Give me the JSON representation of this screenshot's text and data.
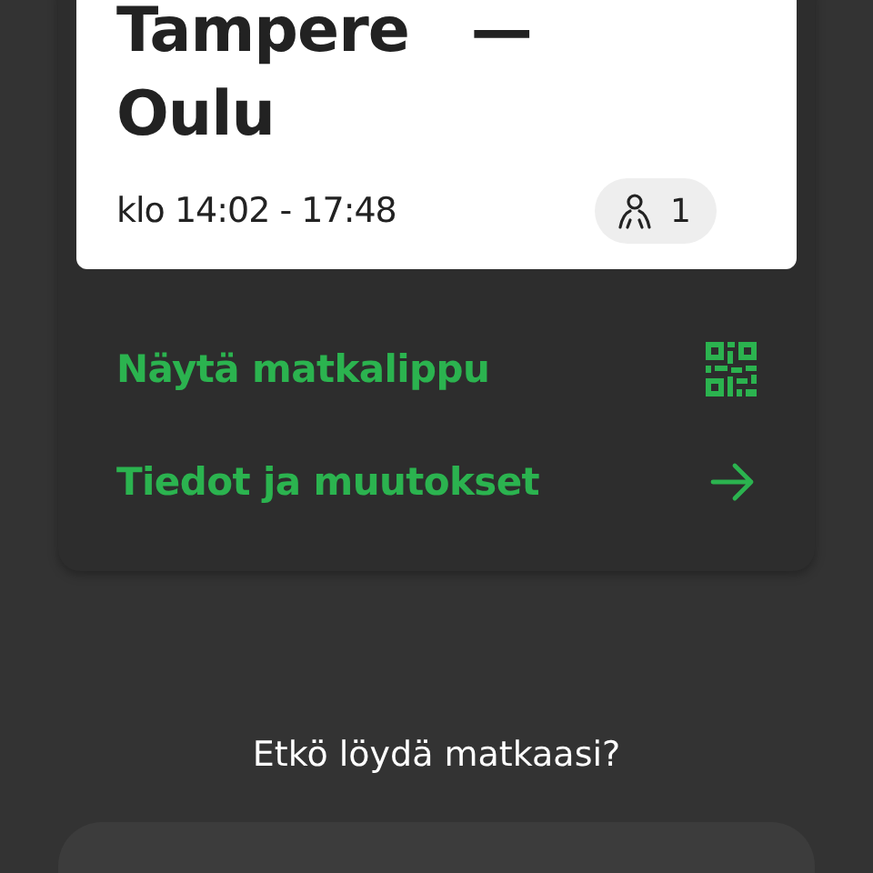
{
  "trip": {
    "origin": "Tampere",
    "separator": "—",
    "destination": "Oulu",
    "time": "klo 14:02 - 17:48",
    "passengers": "1"
  },
  "actions": [
    {
      "label": "Näytä matkalippu",
      "kind": "qr"
    },
    {
      "label": "Tiedot ja muutokset",
      "kind": "arrow"
    }
  ],
  "help": {
    "title": "Etkö löydä matkaasi?"
  }
}
